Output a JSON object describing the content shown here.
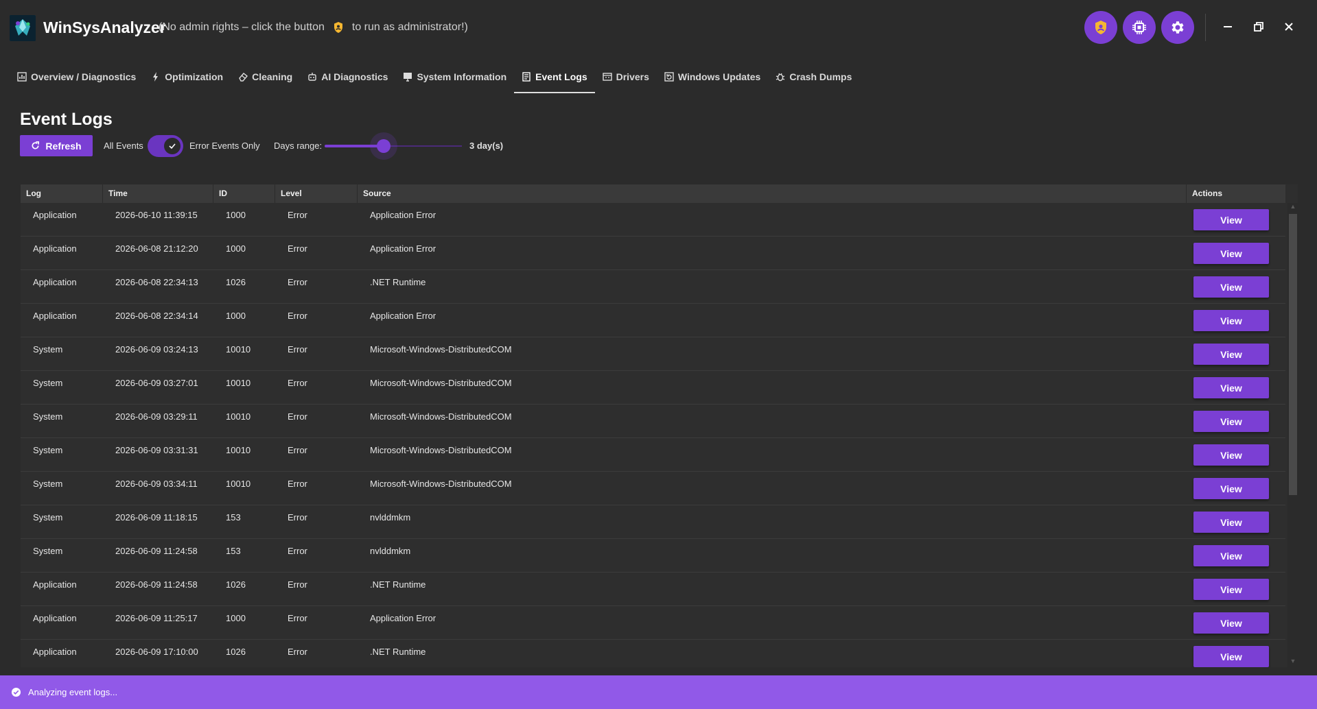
{
  "app": {
    "name": "WinSysAnalyzer",
    "admin_note_prefix": "(No admin rights – click the button",
    "admin_note_suffix": "to run as administrator!)"
  },
  "header_buttons": [
    {
      "icon": "shield-icon"
    },
    {
      "icon": "chip-icon"
    },
    {
      "icon": "gear-icon"
    }
  ],
  "tabs": [
    {
      "label": "Overview / Diagnostics",
      "icon": "chart-icon",
      "active": false
    },
    {
      "label": "Optimization",
      "icon": "lightning-icon",
      "active": false
    },
    {
      "label": "Cleaning",
      "icon": "eraser-icon",
      "active": false
    },
    {
      "label": "AI Diagnostics",
      "icon": "robot-icon",
      "active": false
    },
    {
      "label": "System Information",
      "icon": "monitor-icon",
      "active": false
    },
    {
      "label": "Event Logs",
      "icon": "log-icon",
      "active": true
    },
    {
      "label": "Drivers",
      "icon": "driver-icon",
      "active": false
    },
    {
      "label": "Windows Updates",
      "icon": "update-icon",
      "active": false
    },
    {
      "label": "Crash Dumps",
      "icon": "bug-icon",
      "active": false
    }
  ],
  "page": {
    "title": "Event Logs",
    "refresh_label": "Refresh",
    "all_events_label": "All Events",
    "error_only_label": "Error Events Only",
    "error_only_enabled": true,
    "days_range_label": "Days range:",
    "days_value_label": "3 day(s)",
    "days_fraction": 0.43
  },
  "table": {
    "columns": [
      "Log",
      "Time",
      "ID",
      "Level",
      "Source",
      "Actions"
    ],
    "action_label": "View",
    "rows": [
      {
        "log": "Application",
        "time": "2026-06-10 11:39:15",
        "id": "1000",
        "level": "Error",
        "source": "Application Error"
      },
      {
        "log": "Application",
        "time": "2026-06-08 21:12:20",
        "id": "1000",
        "level": "Error",
        "source": "Application Error"
      },
      {
        "log": "Application",
        "time": "2026-06-08 22:34:13",
        "id": "1026",
        "level": "Error",
        "source": ".NET Runtime"
      },
      {
        "log": "Application",
        "time": "2026-06-08 22:34:14",
        "id": "1000",
        "level": "Error",
        "source": "Application Error"
      },
      {
        "log": "System",
        "time": "2026-06-09 03:24:13",
        "id": "10010",
        "level": "Error",
        "source": "Microsoft-Windows-DistributedCOM"
      },
      {
        "log": "System",
        "time": "2026-06-09 03:27:01",
        "id": "10010",
        "level": "Error",
        "source": "Microsoft-Windows-DistributedCOM"
      },
      {
        "log": "System",
        "time": "2026-06-09 03:29:11",
        "id": "10010",
        "level": "Error",
        "source": "Microsoft-Windows-DistributedCOM"
      },
      {
        "log": "System",
        "time": "2026-06-09 03:31:31",
        "id": "10010",
        "level": "Error",
        "source": "Microsoft-Windows-DistributedCOM"
      },
      {
        "log": "System",
        "time": "2026-06-09 03:34:11",
        "id": "10010",
        "level": "Error",
        "source": "Microsoft-Windows-DistributedCOM"
      },
      {
        "log": "System",
        "time": "2026-06-09 11:18:15",
        "id": "153",
        "level": "Error",
        "source": "nvlddmkm"
      },
      {
        "log": "System",
        "time": "2026-06-09 11:24:58",
        "id": "153",
        "level": "Error",
        "source": "nvlddmkm"
      },
      {
        "log": "Application",
        "time": "2026-06-09 11:24:58",
        "id": "1026",
        "level": "Error",
        "source": ".NET Runtime"
      },
      {
        "log": "Application",
        "time": "2026-06-09 11:25:17",
        "id": "1000",
        "level": "Error",
        "source": "Application Error"
      },
      {
        "log": "Application",
        "time": "2026-06-09 17:10:00",
        "id": "1026",
        "level": "Error",
        "source": ".NET Runtime"
      }
    ]
  },
  "status": {
    "text": "Analyzing event logs..."
  },
  "colors": {
    "accent": "#7b3fd4",
    "status_bar": "#9159e8",
    "background": "#2b2b2b",
    "shield": "#f5b731"
  }
}
